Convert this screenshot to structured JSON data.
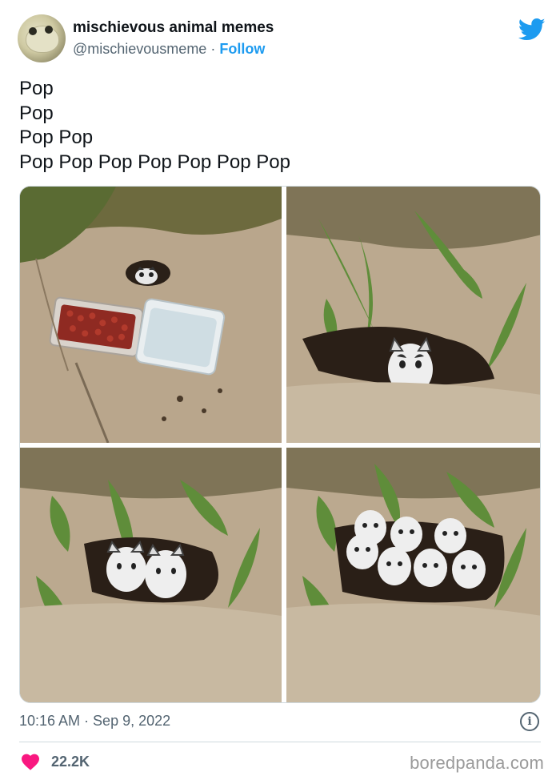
{
  "tweet": {
    "author_name": "mischievous animal memes",
    "handle": "@mischievousmeme",
    "separator": " · ",
    "follow_label": "Follow",
    "text_lines": [
      "Pop",
      "Pop",
      "Pop Pop",
      "Pop Pop Pop Pop Pop Pop Pop"
    ],
    "timestamp": "10:16 AM · Sep 9, 2022",
    "like_count": "22.2K"
  },
  "icons": {
    "platform": "twitter-bird-icon",
    "info": "info-icon",
    "like": "heart-icon"
  },
  "watermark": "boredpanda.com",
  "colors": {
    "accent": "#1d9bf0",
    "secondary_text": "#536471",
    "heart": "#f91880"
  }
}
